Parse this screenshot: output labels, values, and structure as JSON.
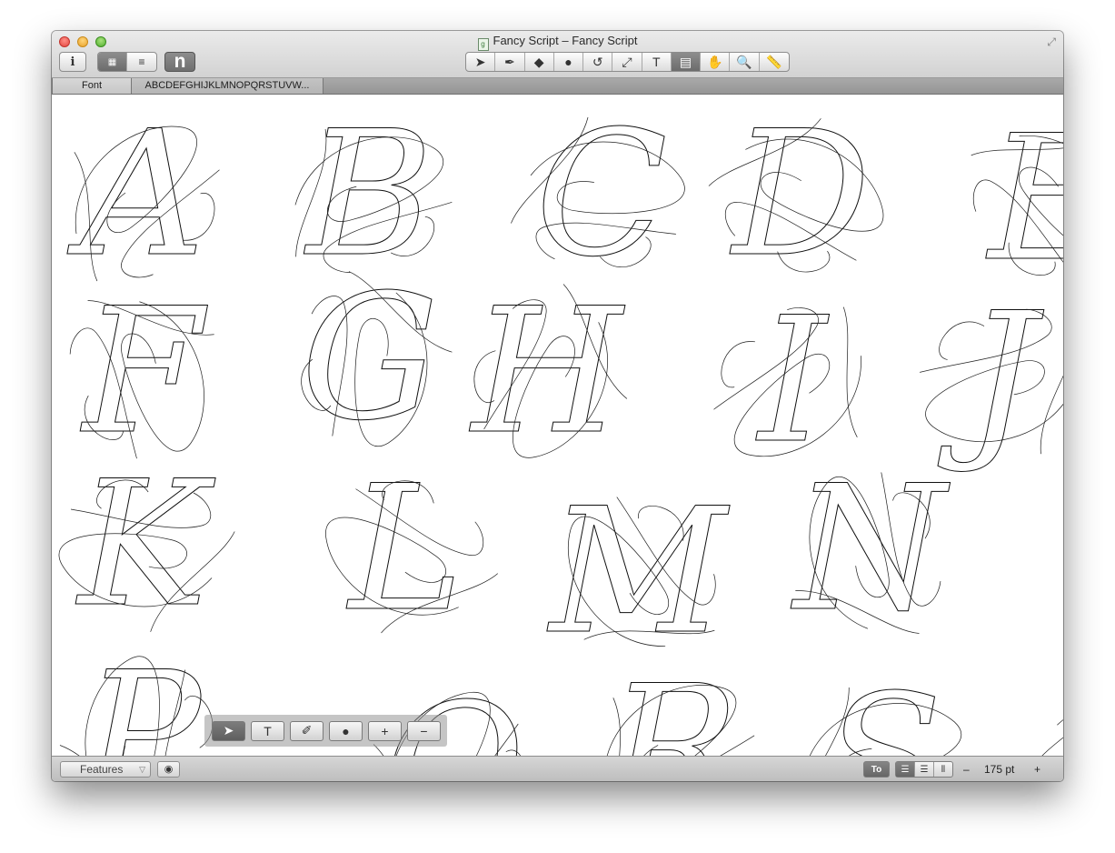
{
  "window": {
    "title": "Fancy Script – Fancy Script",
    "title_icon": "document-icon",
    "fullscreen_icon": "fullscreen-arrows-icon"
  },
  "toolbar_left": {
    "info_label": "i",
    "view_icons": [
      "grid-view-icon",
      "list-view-icon"
    ],
    "glyph_button_label": "n"
  },
  "tools": [
    {
      "name": "pointer-tool",
      "glyph": "➤"
    },
    {
      "name": "pen-tool",
      "glyph": "✒"
    },
    {
      "name": "eraser-tool",
      "glyph": "◆"
    },
    {
      "name": "shape-tool",
      "glyph": "●"
    },
    {
      "name": "rotate-tool",
      "glyph": "↺"
    },
    {
      "name": "scale-tool",
      "glyph": "⤢"
    },
    {
      "name": "text-tool",
      "glyph": "T"
    },
    {
      "name": "annotation-tool",
      "glyph": "▤"
    },
    {
      "name": "hand-tool",
      "glyph": "✋"
    },
    {
      "name": "zoom-tool",
      "glyph": "🔍"
    },
    {
      "name": "measure-tool",
      "glyph": "📏"
    }
  ],
  "tabs": [
    {
      "label": "Font",
      "active": true
    },
    {
      "label": "ABCDEFGHIJKLMNOPQRSTUVW...",
      "active": false
    }
  ],
  "glyphs": [
    "A",
    "B",
    "C",
    "D",
    "E",
    "F",
    "G",
    "H",
    "I",
    "J",
    "K",
    "L",
    "M",
    "N",
    "P",
    "Q",
    "R",
    "S",
    "T"
  ],
  "palette_tools": [
    {
      "name": "palette-pointer",
      "glyph": "➤",
      "active": true
    },
    {
      "name": "palette-text",
      "glyph": "T",
      "active": false
    },
    {
      "name": "palette-pen",
      "glyph": "✐",
      "active": false
    },
    {
      "name": "palette-circle",
      "glyph": "●",
      "active": false
    },
    {
      "name": "palette-add",
      "glyph": "+",
      "active": false
    },
    {
      "name": "palette-remove",
      "glyph": "−",
      "active": false
    }
  ],
  "statusbar": {
    "features_label": "Features",
    "features_arrow": "▽",
    "eye_icon": "eye-icon",
    "zoom_minus": "–",
    "zoom_value": "175 pt",
    "zoom_plus": "+"
  }
}
